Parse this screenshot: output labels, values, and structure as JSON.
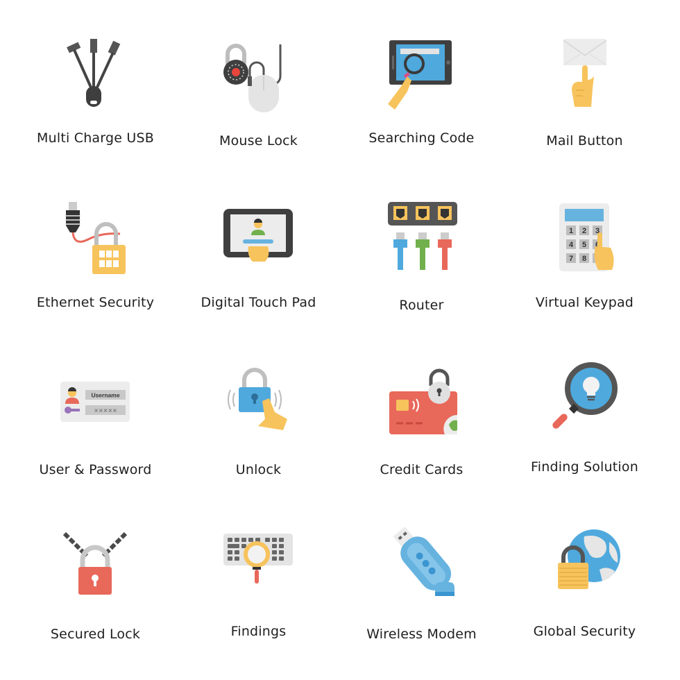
{
  "icon_set": {
    "items": [
      {
        "label": "Multi Charge USB",
        "icon": "multi-charge-usb-icon"
      },
      {
        "label": "Mouse Lock",
        "icon": "mouse-lock-icon"
      },
      {
        "label": "Searching Code",
        "icon": "searching-code-icon"
      },
      {
        "label": "Mail Button",
        "icon": "mail-button-icon"
      },
      {
        "label": "Ethernet Security",
        "icon": "ethernet-security-icon"
      },
      {
        "label": "Digital Touch Pad",
        "icon": "digital-touch-pad-icon"
      },
      {
        "label": "Router",
        "icon": "router-icon"
      },
      {
        "label": "Virtual Keypad",
        "icon": "virtual-keypad-icon",
        "keys": [
          "1",
          "2",
          "3",
          "4",
          "5",
          "6",
          "7",
          "8"
        ]
      },
      {
        "label": "User & Password",
        "icon": "user-password-icon",
        "username_text": "Username",
        "password_text": "✕✕✕✕✕"
      },
      {
        "label": "Unlock",
        "icon": "unlock-icon"
      },
      {
        "label": "Credit Cards",
        "icon": "credit-cards-icon"
      },
      {
        "label": "Finding Solution",
        "icon": "finding-solution-icon"
      },
      {
        "label": "Secured Lock",
        "icon": "secured-lock-icon"
      },
      {
        "label": "Findings",
        "icon": "findings-icon"
      },
      {
        "label": "Wireless Modem",
        "icon": "wireless-modem-icon"
      },
      {
        "label": "Global Security",
        "icon": "global-security-icon"
      }
    ]
  },
  "colors": {
    "dark": "#4a4a4a",
    "light_gray": "#e6e6e6",
    "mid_gray": "#c8c8c8",
    "blue": "#4fa9dd",
    "yellow": "#f7c35c",
    "red": "#e8685a",
    "green": "#72b04d",
    "purple": "#9a73b8",
    "skin": "#f7c35c"
  }
}
